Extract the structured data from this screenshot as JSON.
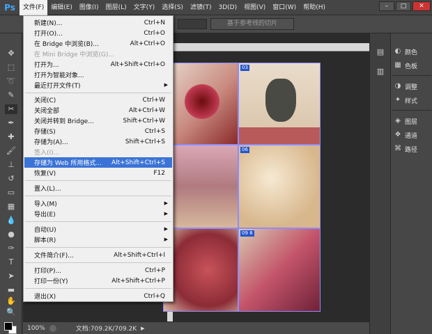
{
  "app": {
    "logo": "Ps"
  },
  "menubar": [
    {
      "label": "文件(F)",
      "active": true
    },
    {
      "label": "编辑(E)"
    },
    {
      "label": "图像(I)"
    },
    {
      "label": "图层(L)"
    },
    {
      "label": "文字(Y)"
    },
    {
      "label": "选择(S)"
    },
    {
      "label": "滤镜(T)"
    },
    {
      "label": "3D(D)"
    },
    {
      "label": "视图(V)"
    },
    {
      "label": "窗口(W)"
    },
    {
      "label": "帮助(H)"
    }
  ],
  "window_controls": {
    "minimize": "–",
    "maximize": "□",
    "close": "✕"
  },
  "options_bar": {
    "slice_button": "基于参考线的切片"
  },
  "file_menu": {
    "items": [
      {
        "label": "新建(N)...",
        "shortcut": "Ctrl+N"
      },
      {
        "label": "打开(O)...",
        "shortcut": "Ctrl+O"
      },
      {
        "label": "在 Bridge 中浏览(B)...",
        "shortcut": "Alt+Ctrl+O"
      },
      {
        "label": "在 Mini Bridge 中浏览(G)...",
        "shortcut": "",
        "disabled": true
      },
      {
        "label": "打开为...",
        "shortcut": "Alt+Shift+Ctrl+O"
      },
      {
        "label": "打开为智能对象...",
        "shortcut": ""
      },
      {
        "label": "最近打开文件(T)",
        "shortcut": "",
        "submenu": true
      },
      {
        "label": "关闭(C)",
        "shortcut": "Ctrl+W"
      },
      {
        "label": "关闭全部",
        "shortcut": "Alt+Ctrl+W"
      },
      {
        "label": "关闭并转到 Bridge...",
        "shortcut": "Shift+Ctrl+W"
      },
      {
        "label": "存储(S)",
        "shortcut": "Ctrl+S"
      },
      {
        "label": "存储为(A)...",
        "shortcut": "Shift+Ctrl+S"
      },
      {
        "label": "签入(I)...",
        "shortcut": "",
        "disabled": true
      },
      {
        "label": "存储为 Web 所用格式...",
        "shortcut": "Alt+Shift+Ctrl+S",
        "highlighted": true
      },
      {
        "label": "恢复(V)",
        "shortcut": "F12"
      },
      {
        "label": "置入(L)...",
        "shortcut": ""
      },
      {
        "label": "导入(M)",
        "shortcut": "",
        "submenu": true
      },
      {
        "label": "导出(E)",
        "shortcut": "",
        "submenu": true
      },
      {
        "label": "自动(U)",
        "shortcut": "",
        "submenu": true
      },
      {
        "label": "脚本(R)",
        "shortcut": "",
        "submenu": true
      },
      {
        "label": "文件简介(F)...",
        "shortcut": "Alt+Shift+Ctrl+I"
      },
      {
        "label": "打印(P)...",
        "shortcut": "Ctrl+P"
      },
      {
        "label": "打印一份(Y)",
        "shortcut": "Alt+Shift+Ctrl+P"
      },
      {
        "label": "退出(X)",
        "shortcut": "Ctrl+Q"
      }
    ]
  },
  "slices": [
    {
      "tag": "03"
    },
    {
      "tag": "06"
    },
    {
      "tag": "09 8"
    }
  ],
  "panels": [
    {
      "label": "颜色",
      "icon": "color-icon"
    },
    {
      "label": "色板",
      "icon": "swatches-icon"
    },
    {
      "label": "调整",
      "icon": "adjustments-icon"
    },
    {
      "label": "样式",
      "icon": "styles-icon"
    },
    {
      "label": "图层",
      "icon": "layers-icon"
    },
    {
      "label": "通道",
      "icon": "channels-icon"
    },
    {
      "label": "路径",
      "icon": "paths-icon"
    }
  ],
  "status": {
    "zoom": "100%",
    "doc": "文档:709.2K/709.2K"
  }
}
